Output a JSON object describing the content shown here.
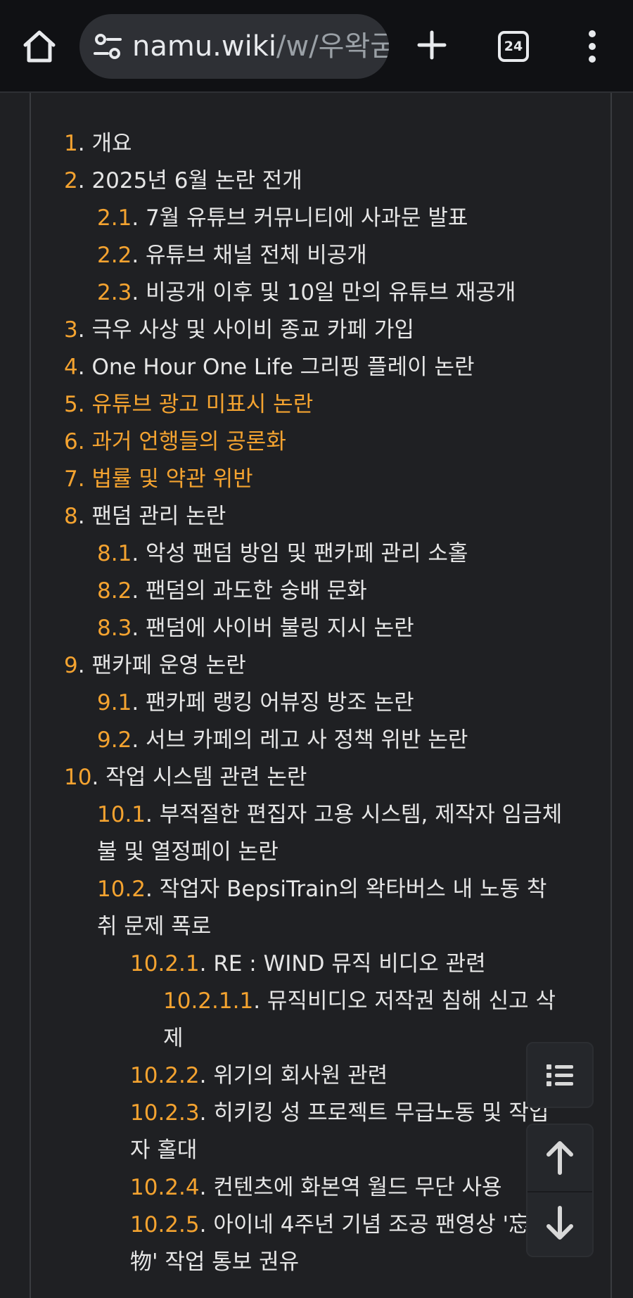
{
  "browser": {
    "url_host": "namu.wiki",
    "url_path": "/w/우왁굳",
    "tab_count": "24",
    "icons": [
      "home-icon",
      "site-settings-icon",
      "new-tab-plus-icon",
      "tab-switcher-icon",
      "overflow-menu-icon"
    ]
  },
  "toc": {
    "heading_fragment": "",
    "items": [
      {
        "num": "1",
        "text": "개요",
        "level": 1
      },
      {
        "num": "2",
        "text": "2025년 6월 논란 전개",
        "level": 1
      },
      {
        "num": "2.1",
        "text": "7월 유튜브 커뮤니티에 사과문 발표",
        "level": 2
      },
      {
        "num": "2.2",
        "text": "유튜브 채널 전체 비공개",
        "level": 2
      },
      {
        "num": "2.3",
        "text": "비공개 이후 및 10일 만의 유튜브 재공개",
        "level": 2
      },
      {
        "num": "3",
        "text": "극우 사상 및 사이비 종교 카페 가입",
        "level": 1
      },
      {
        "num": "4",
        "text": "One Hour One Life 그리핑 플레이 논란",
        "level": 1
      },
      {
        "num": "5",
        "text": "유튜브 광고 미표시 논란",
        "level": 1,
        "highlight": true
      },
      {
        "num": "6",
        "text": "과거 언행들의 공론화",
        "level": 1,
        "highlight": true
      },
      {
        "num": "7",
        "text": "법률 및 약관 위반",
        "level": 1,
        "highlight": true
      },
      {
        "num": "8",
        "text": "팬덤 관리 논란",
        "level": 1
      },
      {
        "num": "8.1",
        "text": "악성 팬덤 방임 및 팬카페 관리 소홀",
        "level": 2
      },
      {
        "num": "8.2",
        "text": "팬덤의 과도한 숭배 문화",
        "level": 2
      },
      {
        "num": "8.3",
        "text": "팬덤에 사이버 불링 지시 논란",
        "level": 2
      },
      {
        "num": "9",
        "text": "팬카페 운영 논란",
        "level": 1
      },
      {
        "num": "9.1",
        "text": "팬카페 랭킹 어뷰징 방조 논란",
        "level": 2
      },
      {
        "num": "9.2",
        "text": "서브 카페의 레고 사 정책 위반 논란",
        "level": 2
      },
      {
        "num": "10",
        "text": "작업 시스템 관련 논란",
        "level": 1
      },
      {
        "num": "10.1",
        "text": "부적절한 편집자 고용 시스템, 제작자 임금체",
        "cont": "불 및 열정페이 논란",
        "level": 2
      },
      {
        "num": "10.2",
        "text": "작업자 BepsiTrain의 왁타버스 내 노동 착",
        "cont": "취 문제 폭로",
        "level": 2
      },
      {
        "num": "10.2.1",
        "text": "RE : WIND 뮤직 비디오 관련",
        "level": 3
      },
      {
        "num": "10.2.1.1",
        "text": "뮤직비디오 저작권 침해 신고 삭",
        "cont": "제",
        "level": 4
      },
      {
        "num": "10.2.2",
        "text": "위기의 회사원 관련",
        "level": 3
      },
      {
        "num": "10.2.3",
        "text": "히키킹 성 프로젝트 무급노동 및 작업",
        "cont": "자 홀대",
        "level": 3
      },
      {
        "num": "10.2.4",
        "text": "컨텐츠에 화본역 월드 무단 사용",
        "level": 3
      },
      {
        "num": "10.2.5",
        "text": "아이네 4주년 기념 조공 팬영상 '忘れ",
        "cont": "物' 작업 통보 권유",
        "level": 3
      }
    ]
  },
  "floating_buttons": {
    "icons": [
      "toc-list-icon",
      "scroll-up-arrow-icon",
      "scroll-down-arrow-icon"
    ]
  }
}
